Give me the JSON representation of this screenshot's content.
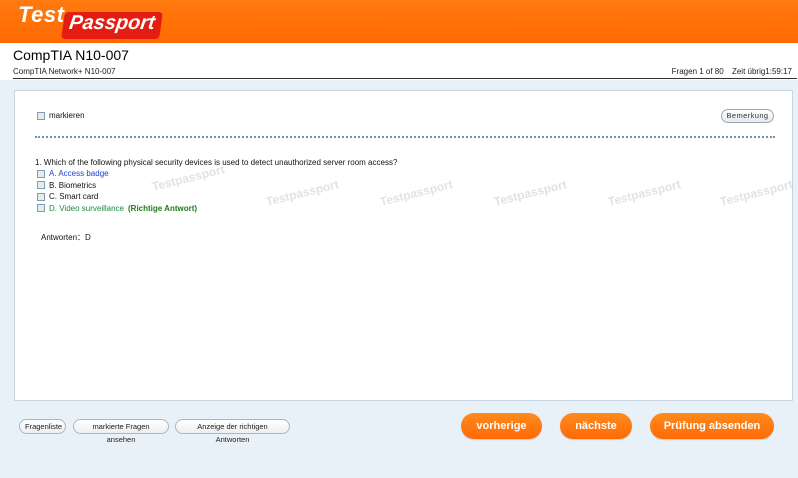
{
  "header": {
    "logo_test": "Test",
    "logo_passport": "Passport"
  },
  "exam": {
    "title": "CompTIA N10-007",
    "subtitle": "CompTIA Network+ N10-007",
    "questions_label": "Fragen 1 of 80",
    "time_label": "Zeit übrig1:59:17"
  },
  "panel": {
    "mark_label": "markieren",
    "note_button": "Bemerkung",
    "question": "1. Which of the following physical security devices is used to detect unauthorized server room access?",
    "options": [
      {
        "text": "A. Access badge"
      },
      {
        "text": "B. Biometrics"
      },
      {
        "text": "C. Smart card"
      },
      {
        "text": "D. Video surveillance"
      }
    ],
    "correct_tag": "(Richtige Antwort)",
    "answer": "Antworten：D",
    "watermark": "Testpassport"
  },
  "footer": {
    "question_list": "Fragenliste",
    "view_marked": "markierte Fragen ansehen",
    "show_correct": "Anzeige der richtigen Antworten",
    "previous": "vorherige",
    "next": "nächste",
    "submit": "Prüfung absenden"
  },
  "colors": {
    "accent_orange": "#ff6a00",
    "logo_red": "#e51c12",
    "option_blue": "#1a3fd6",
    "correct_green": "#1d8a3c"
  }
}
